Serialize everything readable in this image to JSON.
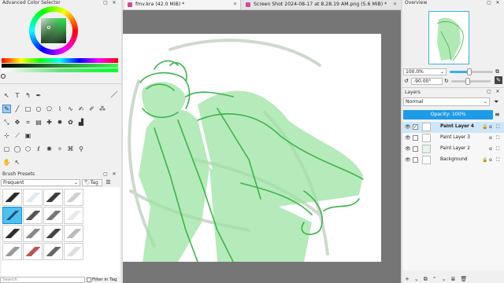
{
  "colors": {
    "accent": "#3daee9",
    "canvas_bg": "#767676",
    "highlight": "#1e9be6",
    "lineart": "#3cb44b",
    "fill": "#9de3a3"
  },
  "left_dock": {
    "color_selector_title": "Advanced Color Selector",
    "brush_presets_title": "Brush Presets",
    "brush_filter_value": "Frequent",
    "tag_label": "Tag",
    "search_placeholder": "Search",
    "filter_in_tag_label": "Filter in Tag"
  },
  "tabs": [
    {
      "label": "fmv.kra (42.0 MiB) *",
      "close": "✕"
    },
    {
      "label": "Screen Shot 2024-08-17 at 8.28.19 AM.png (5.6 MiB) *",
      "close": "✕"
    }
  ],
  "overview": {
    "title": "Overview",
    "zoom_value": "100.0%",
    "rotation_value": "-90.00°"
  },
  "layers": {
    "title": "Layers",
    "blend_mode": "Normal",
    "opacity_label": "Opacity: 100%",
    "items": [
      {
        "name": "Paint Layer 4",
        "selected": true
      },
      {
        "name": "Paint Layer 3",
        "selected": false
      },
      {
        "name": "Paint Layer 2",
        "selected": false
      },
      {
        "name": "Background",
        "selected": false
      }
    ]
  }
}
